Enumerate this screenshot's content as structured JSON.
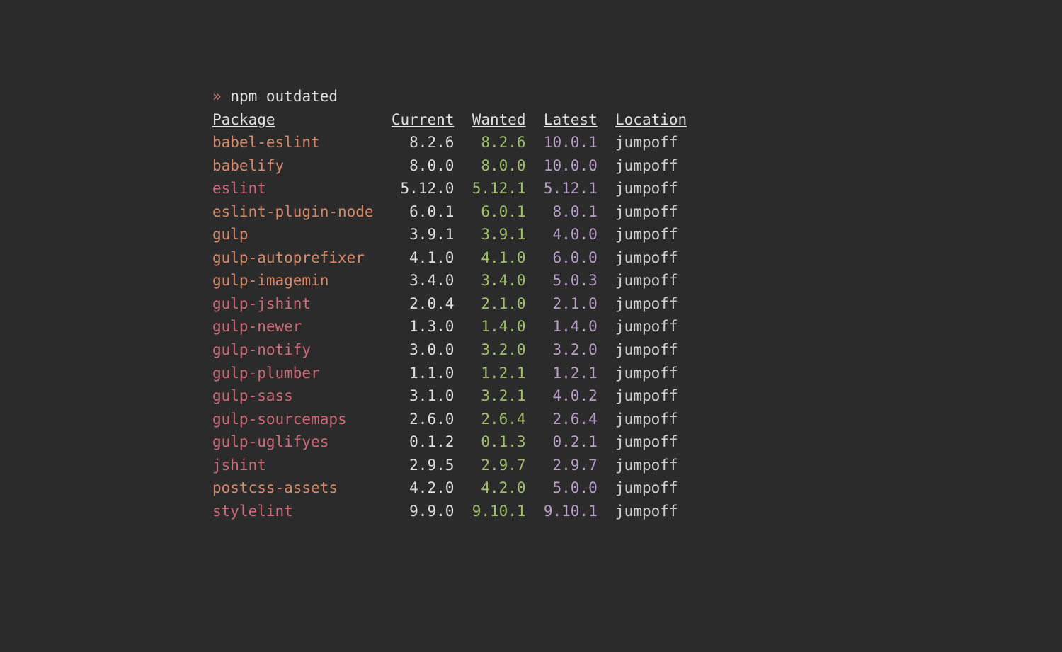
{
  "prompt": {
    "symbol": "»",
    "command": "npm outdated"
  },
  "headers": {
    "package": "Package",
    "current": "Current",
    "wanted": "Wanted",
    "latest": "Latest",
    "location": "Location"
  },
  "cols": {
    "package": 18,
    "current": 8,
    "wanted": 7,
    "latest": 7
  },
  "rows": [
    {
      "package": "babel-eslint",
      "current": "8.2.6",
      "wanted": "8.2.6",
      "latest": "10.0.1",
      "location": "jumpoff",
      "pkg_color": "pkg"
    },
    {
      "package": "babelify",
      "current": "8.0.0",
      "wanted": "8.0.0",
      "latest": "10.0.0",
      "location": "jumpoff",
      "pkg_color": "pkg"
    },
    {
      "package": "eslint",
      "current": "5.12.0",
      "wanted": "5.12.1",
      "latest": "5.12.1",
      "location": "jumpoff",
      "pkg_color": "pkg-red"
    },
    {
      "package": "eslint-plugin-node",
      "current": "6.0.1",
      "wanted": "6.0.1",
      "latest": "8.0.1",
      "location": "jumpoff",
      "pkg_color": "pkg"
    },
    {
      "package": "gulp",
      "current": "3.9.1",
      "wanted": "3.9.1",
      "latest": "4.0.0",
      "location": "jumpoff",
      "pkg_color": "pkg"
    },
    {
      "package": "gulp-autoprefixer",
      "current": "4.1.0",
      "wanted": "4.1.0",
      "latest": "6.0.0",
      "location": "jumpoff",
      "pkg_color": "pkg"
    },
    {
      "package": "gulp-imagemin",
      "current": "3.4.0",
      "wanted": "3.4.0",
      "latest": "5.0.3",
      "location": "jumpoff",
      "pkg_color": "pkg"
    },
    {
      "package": "gulp-jshint",
      "current": "2.0.4",
      "wanted": "2.1.0",
      "latest": "2.1.0",
      "location": "jumpoff",
      "pkg_color": "pkg-red"
    },
    {
      "package": "gulp-newer",
      "current": "1.3.0",
      "wanted": "1.4.0",
      "latest": "1.4.0",
      "location": "jumpoff",
      "pkg_color": "pkg-red"
    },
    {
      "package": "gulp-notify",
      "current": "3.0.0",
      "wanted": "3.2.0",
      "latest": "3.2.0",
      "location": "jumpoff",
      "pkg_color": "pkg-red"
    },
    {
      "package": "gulp-plumber",
      "current": "1.1.0",
      "wanted": "1.2.1",
      "latest": "1.2.1",
      "location": "jumpoff",
      "pkg_color": "pkg-red"
    },
    {
      "package": "gulp-sass",
      "current": "3.1.0",
      "wanted": "3.2.1",
      "latest": "4.0.2",
      "location": "jumpoff",
      "pkg_color": "pkg-red"
    },
    {
      "package": "gulp-sourcemaps",
      "current": "2.6.0",
      "wanted": "2.6.4",
      "latest": "2.6.4",
      "location": "jumpoff",
      "pkg_color": "pkg-red"
    },
    {
      "package": "gulp-uglifyes",
      "current": "0.1.2",
      "wanted": "0.1.3",
      "latest": "0.2.1",
      "location": "jumpoff",
      "pkg_color": "pkg-red"
    },
    {
      "package": "jshint",
      "current": "2.9.5",
      "wanted": "2.9.7",
      "latest": "2.9.7",
      "location": "jumpoff",
      "pkg_color": "pkg-red"
    },
    {
      "package": "postcss-assets",
      "current": "4.2.0",
      "wanted": "4.2.0",
      "latest": "5.0.0",
      "location": "jumpoff",
      "pkg_color": "pkg"
    },
    {
      "package": "stylelint",
      "current": "9.9.0",
      "wanted": "9.10.1",
      "latest": "9.10.1",
      "location": "jumpoff",
      "pkg_color": "pkg-red"
    }
  ]
}
